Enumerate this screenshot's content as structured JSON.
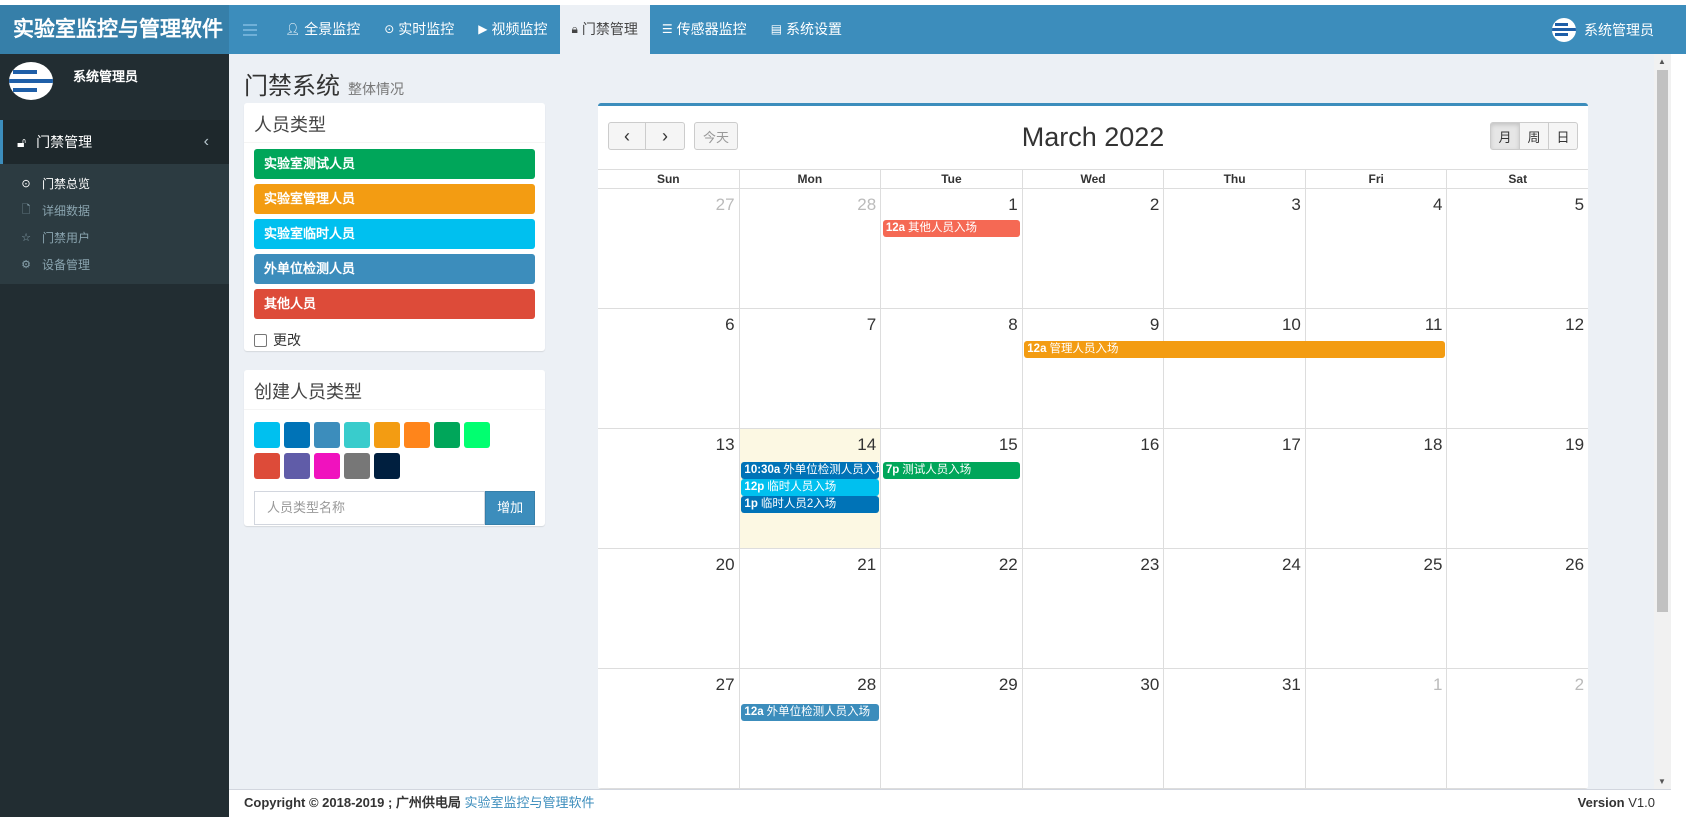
{
  "app": {
    "title": "实验室监控与管理软件"
  },
  "nav": [
    {
      "label": "全景监控",
      "icon": "user-icon"
    },
    {
      "label": "实时监控",
      "icon": "clock-icon"
    },
    {
      "label": "视频监控",
      "icon": "video-icon"
    },
    {
      "label": "门禁管理",
      "icon": "lock-icon",
      "active": true
    },
    {
      "label": "传感器监控",
      "icon": "list-icon"
    },
    {
      "label": "系统设置",
      "icon": "window-icon"
    }
  ],
  "user": {
    "name": "系统管理员"
  },
  "sidebar": {
    "user_name": "系统管理员",
    "section": "门禁管理",
    "items": [
      {
        "label": "门禁总览",
        "icon": "clock-icon",
        "active": true
      },
      {
        "label": "详细数据",
        "icon": "file-icon"
      },
      {
        "label": "门禁用户",
        "icon": "star-icon"
      },
      {
        "label": "设备管理",
        "icon": "gear-icon"
      }
    ]
  },
  "page": {
    "title": "门禁系统",
    "subtitle": "整体情况"
  },
  "person_types": {
    "title": "人员类型",
    "items": [
      {
        "label": "实验室测试人员",
        "color": "#00a65a"
      },
      {
        "label": "实验室管理人员",
        "color": "#f39c12"
      },
      {
        "label": "实验室临时人员",
        "color": "#00c0ef"
      },
      {
        "label": "外单位检测人员",
        "color": "#3c8dbc"
      },
      {
        "label": "其他人员",
        "color": "#dd4b39"
      }
    ],
    "checkbox_label": "更改"
  },
  "create_type": {
    "title": "创建人员类型",
    "colors": [
      "#00c0ef",
      "#0073b7",
      "#3c8dbc",
      "#39cccc",
      "#f39c12",
      "#ff851b",
      "#00a65a",
      "#01ff70",
      "#dd4b39",
      "#605ca8",
      "#f012be",
      "#777777",
      "#001f3f"
    ],
    "input_placeholder": "人员类型名称",
    "button_label": "增加"
  },
  "calendar": {
    "title": "March 2022",
    "today_label": "今天",
    "views": [
      "月",
      "周",
      "日"
    ],
    "weekdays": [
      "Sun",
      "Mon",
      "Tue",
      "Wed",
      "Thu",
      "Fri",
      "Sat"
    ],
    "weeks": [
      [
        {
          "d": "27",
          "o": true
        },
        {
          "d": "28",
          "o": true
        },
        {
          "d": "1"
        },
        {
          "d": "2"
        },
        {
          "d": "3"
        },
        {
          "d": "4"
        },
        {
          "d": "5"
        }
      ],
      [
        {
          "d": "6"
        },
        {
          "d": "7"
        },
        {
          "d": "8"
        },
        {
          "d": "9"
        },
        {
          "d": "10"
        },
        {
          "d": "11"
        },
        {
          "d": "12"
        }
      ],
      [
        {
          "d": "13"
        },
        {
          "d": "14",
          "today": true
        },
        {
          "d": "15"
        },
        {
          "d": "16"
        },
        {
          "d": "17"
        },
        {
          "d": "18"
        },
        {
          "d": "19"
        }
      ],
      [
        {
          "d": "20"
        },
        {
          "d": "21"
        },
        {
          "d": "22"
        },
        {
          "d": "23"
        },
        {
          "d": "24"
        },
        {
          "d": "25"
        },
        {
          "d": "26"
        }
      ],
      [
        {
          "d": "27"
        },
        {
          "d": "28"
        },
        {
          "d": "29"
        },
        {
          "d": "30"
        },
        {
          "d": "31"
        },
        {
          "d": "1",
          "o": true
        },
        {
          "d": "2",
          "o": true
        }
      ]
    ],
    "events": [
      {
        "time": "12a",
        "title": "其他人员入场",
        "week": 0,
        "day": 2,
        "span": 1,
        "slot": 0,
        "color": "#f56954"
      },
      {
        "time": "12a",
        "title": "管理人员入场",
        "week": 1,
        "day": 3,
        "span": 3,
        "slot": 0,
        "color": "#f39c12"
      },
      {
        "time": "10:30a",
        "title": "外单位检测人员入场",
        "week": 2,
        "day": 1,
        "span": 1,
        "slot": 0,
        "color": "#0073b7"
      },
      {
        "time": "7p",
        "title": "测试人员入场",
        "week": 2,
        "day": 2,
        "span": 1,
        "slot": 0,
        "color": "#00a65a"
      },
      {
        "time": "12p",
        "title": "临时人员入场",
        "week": 2,
        "day": 1,
        "span": 1,
        "slot": 1,
        "color": "#00c0ef"
      },
      {
        "time": "1p",
        "title": "临时人员2入场",
        "week": 2,
        "day": 1,
        "span": 1,
        "slot": 2,
        "color": "#0073b7"
      },
      {
        "time": "12a",
        "title": "外单位检测人员入场",
        "week": 4,
        "day": 1,
        "span": 1,
        "slot": 0,
        "color": "#3c8dbc"
      }
    ]
  },
  "footer": {
    "copyright": "Copyright © 2018-2019 ; 广州供电局",
    "link": "实验室监控与管理软件",
    "version_label": "Version",
    "version": "V1.0"
  }
}
